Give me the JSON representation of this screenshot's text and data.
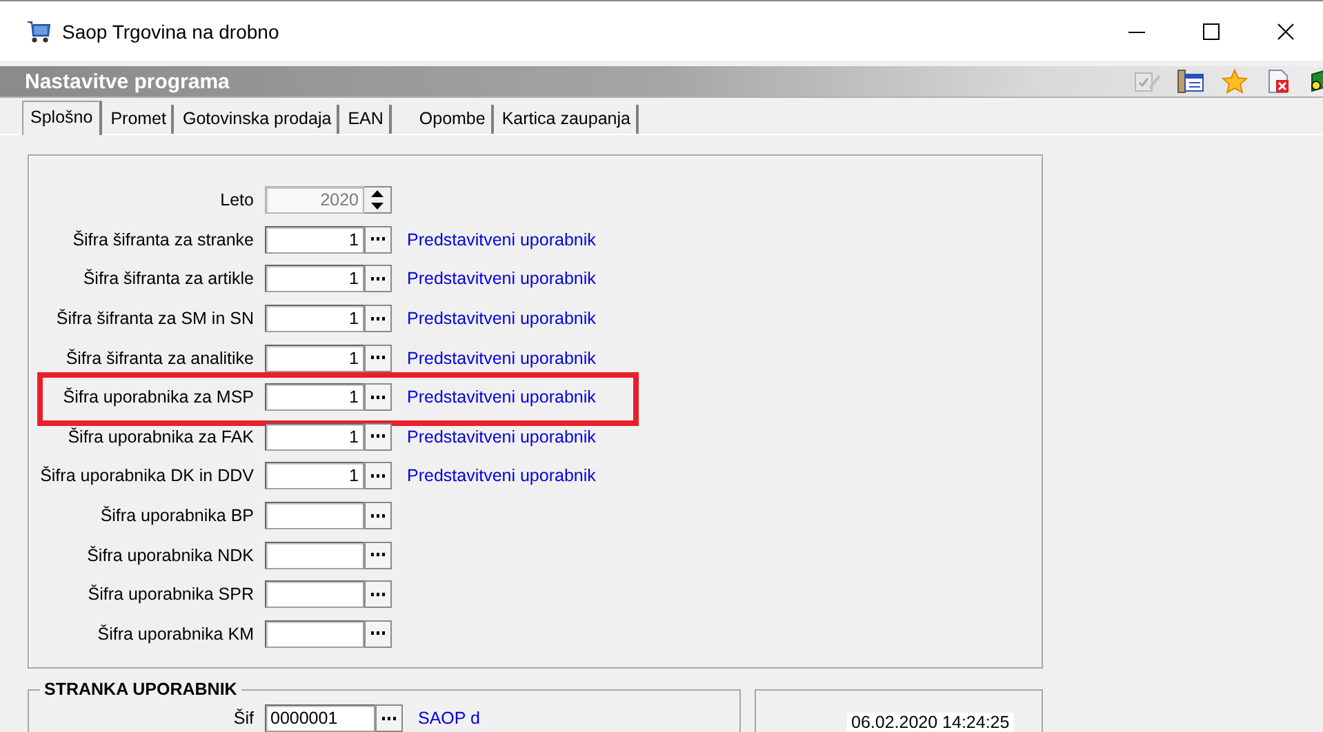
{
  "window": {
    "title": "Saop Trgovina na drobno"
  },
  "header": {
    "title": "Nastavitve programa"
  },
  "tabs": [
    {
      "label": "Splošno",
      "selected": true
    },
    {
      "label": "Promet",
      "selected": false
    },
    {
      "label": "Gotovinska prodaja",
      "selected": false
    },
    {
      "label": "EAN",
      "selected": false
    },
    {
      "label": "Opombe",
      "selected": false
    },
    {
      "label": "Kartica zaupanja",
      "selected": false
    }
  ],
  "fields": [
    {
      "kind": "spinner",
      "label": "Leto",
      "value": "2020",
      "disabled": true,
      "highlighted": false
    },
    {
      "kind": "lookup",
      "label": "Šifra šifranta za stranke",
      "value": "1",
      "link": "Predstavitveni uporabnik",
      "disabled": false,
      "highlighted": false
    },
    {
      "kind": "lookup",
      "label": "Šifra šifranta za artikle",
      "value": "1",
      "link": "Predstavitveni uporabnik",
      "disabled": false,
      "highlighted": false
    },
    {
      "kind": "lookup",
      "label": "Šifra šifranta za SM in SN",
      "value": "1",
      "link": "Predstavitveni uporabnik",
      "disabled": false,
      "highlighted": false
    },
    {
      "kind": "lookup",
      "label": "Šifra šifranta za analitike",
      "value": "1",
      "link": "Predstavitveni uporabnik",
      "disabled": false,
      "highlighted": false
    },
    {
      "kind": "lookup",
      "label": "Šifra uporabnika za MSP",
      "value": "1",
      "link": "Predstavitveni uporabnik",
      "disabled": false,
      "highlighted": true
    },
    {
      "kind": "lookup",
      "label": "Šifra uporabnika za FAK",
      "value": "1",
      "link": "Predstavitveni uporabnik",
      "disabled": false,
      "highlighted": false
    },
    {
      "kind": "lookup",
      "label": "Šifra uporabnika DK in DDV",
      "value": "1",
      "link": "Predstavitveni uporabnik",
      "disabled": false,
      "highlighted": false
    },
    {
      "kind": "lookup",
      "label": "Šifra uporabnika BP",
      "disabled": false,
      "highlighted": false
    },
    {
      "kind": "lookup",
      "label": "Šifra uporabnika NDK",
      "disabled": false,
      "highlighted": false
    },
    {
      "kind": "lookup",
      "label": "Šifra uporabnika SPR",
      "disabled": false,
      "highlighted": false
    },
    {
      "kind": "lookup",
      "label": "Šifra uporabnika KM",
      "disabled": false,
      "highlighted": false
    }
  ],
  "customer_group": {
    "title": "STRANKA UPORABNIK",
    "fields": [
      {
        "kind": "lookup",
        "label": "Šif",
        "value": "0000001",
        "link": "SAOP d"
      }
    ]
  },
  "status_panel": {
    "datetime": "06.02.2020 14:24:25"
  }
}
